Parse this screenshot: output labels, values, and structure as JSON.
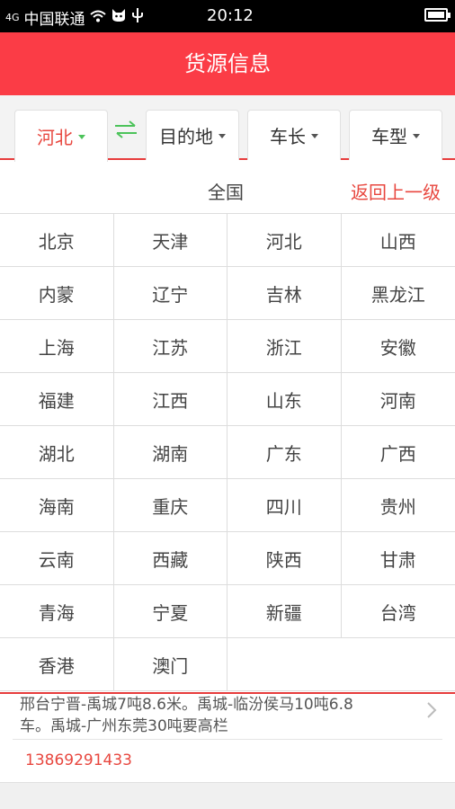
{
  "statusbar": {
    "signal_label": "4G",
    "carrier": "中国联通",
    "time": "20:12"
  },
  "header": {
    "title": "货源信息"
  },
  "filters": {
    "origin": "河北",
    "destination": "目的地",
    "length": "车长",
    "type": "车型"
  },
  "panel": {
    "national": "全国",
    "back": "返回上一级",
    "provinces": [
      [
        "北京",
        "天津",
        "河北",
        "山西"
      ],
      [
        "内蒙",
        "辽宁",
        "吉林",
        "黑龙江"
      ],
      [
        "上海",
        "江苏",
        "浙江",
        "安徽"
      ],
      [
        "福建",
        "江西",
        "山东",
        "河南"
      ],
      [
        "湖北",
        "湖南",
        "广东",
        "广西"
      ],
      [
        "海南",
        "重庆",
        "四川",
        "贵州"
      ],
      [
        "云南",
        "西藏",
        "陕西",
        "甘肃"
      ],
      [
        "青海",
        "宁夏",
        "新疆",
        "台湾"
      ],
      [
        "香港",
        "澳门",
        "",
        ""
      ]
    ]
  },
  "listing": {
    "description_line1": "邢台宁晋-禹城7吨8.6米。禹城-临汾侯马10吨6.8",
    "description_line2": "车。禹城-广州东莞30吨要高栏",
    "phone": "13869291433"
  },
  "colors": {
    "accent": "#fb3c46",
    "green": "#4cc35a"
  }
}
